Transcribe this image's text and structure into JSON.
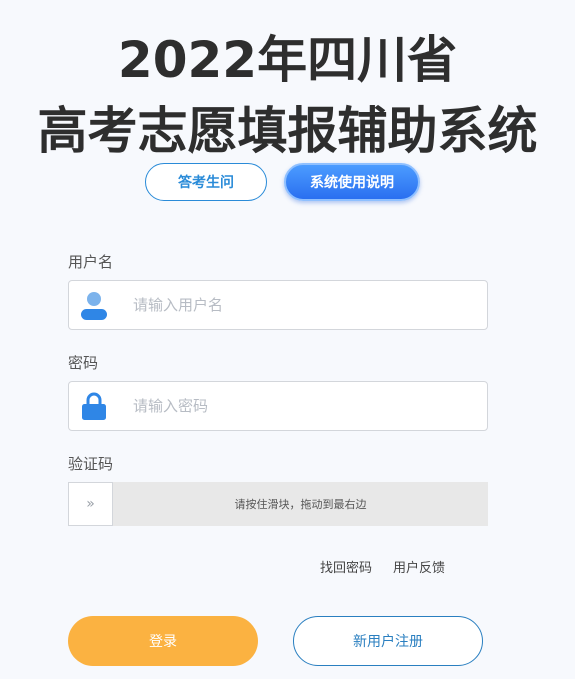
{
  "header": {
    "title_line1": "2022年四川省",
    "title_line2": "高考志愿填报辅助系统"
  },
  "top_buttons": {
    "ask_label": "答考生问",
    "guide_label": "系统使用说明"
  },
  "form": {
    "username": {
      "label": "用户名",
      "placeholder": "请输入用户名",
      "value": "",
      "icon": "user-icon"
    },
    "password": {
      "label": "密码",
      "placeholder": "请输入密码",
      "value": "",
      "icon": "lock-icon"
    },
    "captcha": {
      "label": "验证码",
      "handle_glyph": "»",
      "hint": "请按住滑块，拖动到最右边",
      "progress": 0
    }
  },
  "links": {
    "forgot_password": "找回密码",
    "feedback": "用户反馈"
  },
  "actions": {
    "login_label": "登录",
    "register_label": "新用户注册"
  },
  "colors": {
    "accent_blue": "#2a8bd8",
    "guide_button_blue": "#2a6ff0",
    "login_orange": "#fbb241",
    "register_blue": "#2a7fc0",
    "icon_blue": "#2f86e6",
    "background": "#f7f9fd"
  }
}
